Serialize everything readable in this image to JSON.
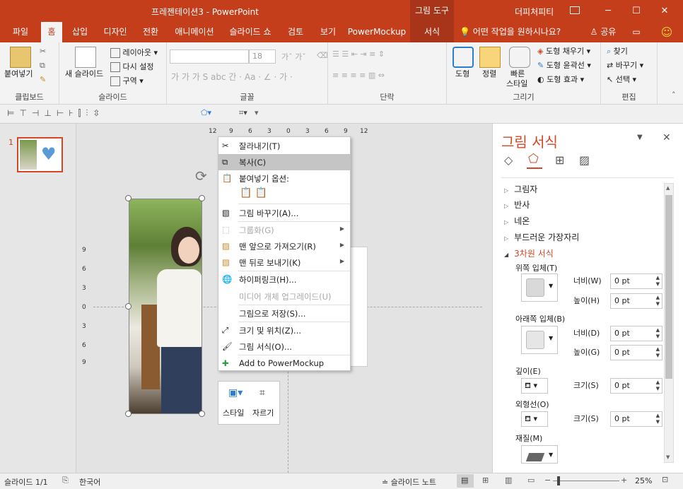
{
  "window": {
    "title": "프레젠테이션3 - PowerPoint",
    "context_tool": "그림 도구",
    "user": "더피처피티",
    "controls": {
      "minimize": "─",
      "restore": "☐",
      "close": "✕"
    }
  },
  "tabs": [
    {
      "label": "파일"
    },
    {
      "label": "홈"
    },
    {
      "label": "삽입"
    },
    {
      "label": "디자인"
    },
    {
      "label": "전환"
    },
    {
      "label": "애니메이션"
    },
    {
      "label": "슬라이드 쇼"
    },
    {
      "label": "검토"
    },
    {
      "label": "보기"
    },
    {
      "label": "PowerMockup"
    },
    {
      "label": "서식"
    }
  ],
  "tell_me": "어떤 작업을 원하시나요?",
  "share": "공유",
  "ribbon": {
    "clipboard": {
      "label": "클립보드",
      "paste": "붙여넣기"
    },
    "slides": {
      "label": "슬라이드",
      "new_slide": "새 슬라이드",
      "layout": "레이아웃",
      "reset": "다시 설정",
      "section": "구역"
    },
    "font": {
      "label": "글꼴",
      "size": "18"
    },
    "paragraph": {
      "label": "단락"
    },
    "drawing": {
      "label": "그리기",
      "shapes": "도형",
      "arrange": "정렬",
      "quick_styles_1": "빠른",
      "quick_styles_2": "스타일",
      "fill": "도형 채우기",
      "outline": "도형 윤곽선",
      "effects": "도형 효과"
    },
    "editing": {
      "label": "편집",
      "find": "찾기",
      "replace": "바꾸기",
      "select": "선택"
    }
  },
  "thumbnail": {
    "number": "1"
  },
  "rulers": {
    "top": [
      "12",
      "9",
      "6",
      "3",
      "0",
      "3",
      "6",
      "9",
      "12"
    ],
    "left": [
      "9",
      "6",
      "3",
      "0",
      "3",
      "6",
      "9"
    ]
  },
  "context_menu": {
    "items": [
      {
        "label": "잘라내기(T)",
        "state": "normal"
      },
      {
        "label": "복사(C)",
        "state": "highlighted"
      },
      {
        "label": "붙여넣기 옵션:",
        "state": "header"
      },
      {
        "label": "그림 바꾸기(A)...",
        "state": "normal"
      },
      {
        "label": "그룹화(G)",
        "state": "disabled"
      },
      {
        "label": "맨 앞으로 가져오기(R)",
        "state": "normal"
      },
      {
        "label": "맨 뒤로 보내기(K)",
        "state": "normal"
      },
      {
        "label": "하이퍼링크(H)...",
        "state": "normal"
      },
      {
        "label": "미디어 개체 업그레이드(U)",
        "state": "disabled"
      },
      {
        "label": "그림으로 저장(S)...",
        "state": "normal"
      },
      {
        "label": "크기 및 위치(Z)...",
        "state": "normal"
      },
      {
        "label": "그림 서식(O)...",
        "state": "normal"
      },
      {
        "label": "Add to PowerMockup",
        "state": "normal"
      }
    ]
  },
  "mini_toolbar": {
    "style": "스타일",
    "crop": "자르기"
  },
  "pane": {
    "title": "그림 서식",
    "sections": [
      "그림자",
      "반사",
      "네온",
      "부드러운 가장자리",
      "3차원 서식"
    ],
    "top_bevel": "위쪽 입체(T)",
    "bottom_bevel": "아래쪽 입체(B)",
    "width_label": "너비(W)",
    "height_label": "높이(H)",
    "width_label_b": "너비(D)",
    "height_label_b": "높이(G)",
    "depth": "깊이(E)",
    "contour": "외형선(O)",
    "size_label": "크기(S)",
    "material": "재질(M)",
    "value": "0 pt",
    "accent": "#d24726"
  },
  "status": {
    "slide": "슬라이드 1/1",
    "language": "한국어",
    "notes": "슬라이드 노트",
    "zoom": "25%"
  }
}
